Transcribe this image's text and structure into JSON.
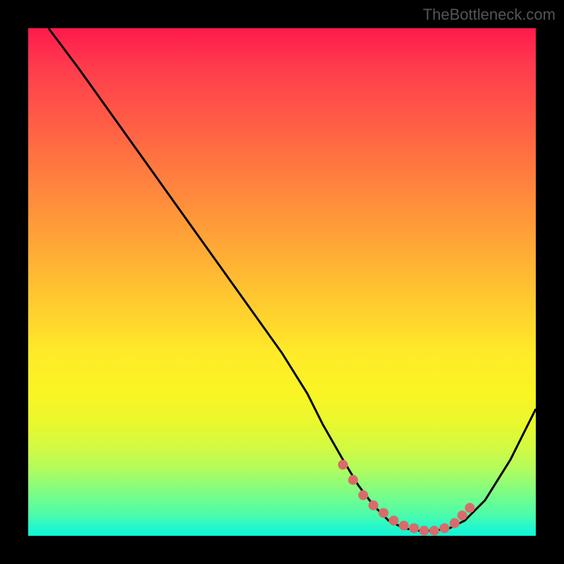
{
  "watermark": "TheBottleneck.com",
  "chart_data": {
    "type": "line",
    "title": "",
    "xlabel": "",
    "ylabel": "",
    "xlim": [
      0,
      100
    ],
    "ylim": [
      0,
      100
    ],
    "series": [
      {
        "name": "bottleneck-curve",
        "x": [
          4,
          10,
          15,
          20,
          25,
          30,
          35,
          40,
          45,
          50,
          55,
          58,
          62,
          65,
          68,
          71,
          74,
          77,
          80,
          83,
          86,
          90,
          95,
          100
        ],
        "y": [
          100,
          92,
          85,
          78,
          71,
          64,
          57,
          50,
          43,
          36,
          28,
          22,
          15,
          10,
          6,
          3,
          1.5,
          1,
          1,
          1.5,
          3,
          7,
          15,
          25
        ]
      },
      {
        "name": "highlight-dots",
        "x": [
          62,
          64,
          66,
          68,
          70,
          72,
          74,
          76,
          78,
          80,
          82,
          84,
          85.5,
          87
        ],
        "y": [
          14,
          11,
          8,
          6,
          4.5,
          3,
          2,
          1.5,
          1,
          1,
          1.5,
          2.5,
          4,
          5.5
        ]
      }
    ],
    "colors": {
      "curve": "#000000",
      "dots": "#d96b6b"
    }
  }
}
